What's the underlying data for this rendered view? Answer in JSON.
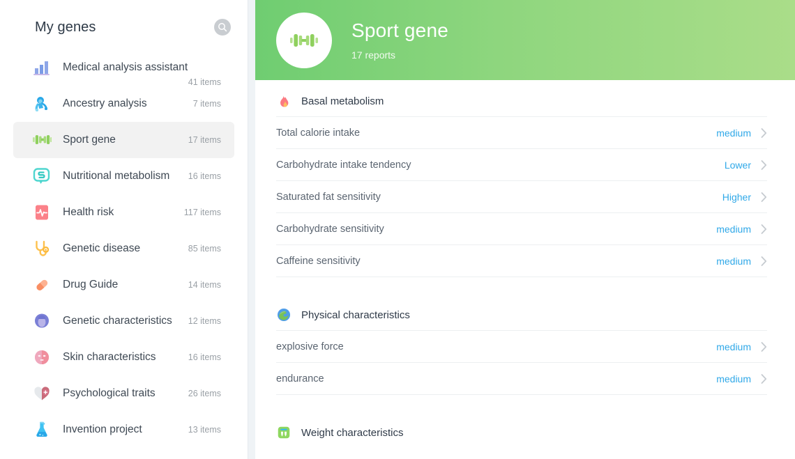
{
  "sidebar": {
    "title": "My genes",
    "search_icon": "search-icon",
    "items": [
      {
        "label": "Medical analysis assistant",
        "count": "41 items",
        "icon": "bar-chart-icon",
        "active": false,
        "overflow": true
      },
      {
        "label": "Ancestry analysis",
        "count": "7 items",
        "icon": "ape-icon",
        "active": false,
        "overflow": false
      },
      {
        "label": "Sport gene",
        "count": "17 items",
        "icon": "dumbbell-icon",
        "active": true,
        "overflow": false
      },
      {
        "label": "Nutritional metabolism",
        "count": "16 items",
        "icon": "chat-bubble-icon",
        "active": false,
        "overflow": false
      },
      {
        "label": "Health risk",
        "count": "117 items",
        "icon": "heartbeat-icon",
        "active": false,
        "overflow": false
      },
      {
        "label": "Genetic disease",
        "count": "85 items",
        "icon": "stethoscope-icon",
        "active": false,
        "overflow": false
      },
      {
        "label": "Drug Guide",
        "count": "14 items",
        "icon": "pill-icon",
        "active": false,
        "overflow": false
      },
      {
        "label": "Genetic characteristics",
        "count": "12 items",
        "icon": "person-head-icon",
        "active": false,
        "overflow": false
      },
      {
        "label": "Skin characteristics",
        "count": "16 items",
        "icon": "face-mask-icon",
        "active": false,
        "overflow": false
      },
      {
        "label": "Psychological traits",
        "count": "26 items",
        "icon": "heart-plus-icon",
        "active": false,
        "overflow": false
      },
      {
        "label": "Invention project",
        "count": "13 items",
        "icon": "flask-icon",
        "active": false,
        "overflow": false
      }
    ]
  },
  "hero": {
    "title": "Sport gene",
    "subtitle": "17 reports",
    "icon": "dumbbell-icon",
    "gradient_from": "#6fcd71",
    "gradient_to": "#aadd89"
  },
  "colors": {
    "value_blue": "#2fa8e8",
    "page_bg": "#eff3f6",
    "active_row": "#f2f2f2"
  },
  "sections": [
    {
      "title": "Basal metabolism",
      "icon": "flame-icon",
      "rows": [
        {
          "label": "Total calorie intake",
          "value": "medium"
        },
        {
          "label": "Carbohydrate intake tendency",
          "value": "Lower"
        },
        {
          "label": "Saturated fat sensitivity",
          "value": "Higher"
        },
        {
          "label": "Carbohydrate sensitivity",
          "value": "medium"
        },
        {
          "label": "Caffeine sensitivity",
          "value": "medium"
        }
      ]
    },
    {
      "title": "Physical characteristics",
      "icon": "muscle-globe-icon",
      "rows": [
        {
          "label": "explosive force",
          "value": "medium"
        },
        {
          "label": "endurance",
          "value": "medium"
        }
      ]
    },
    {
      "title": "Weight characteristics",
      "icon": "scale-icon",
      "rows": []
    }
  ]
}
